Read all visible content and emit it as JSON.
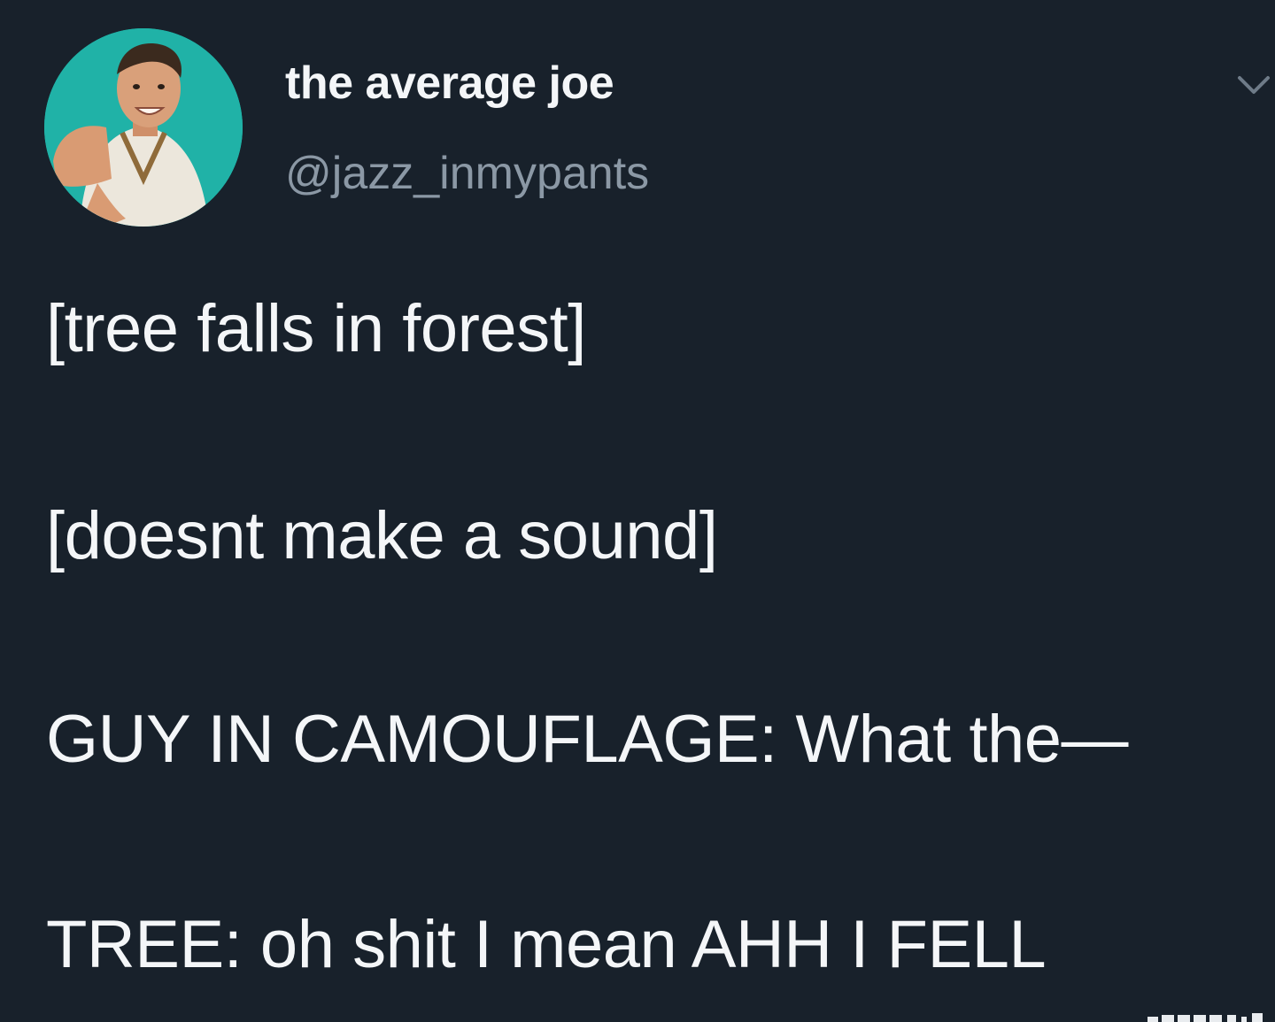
{
  "author": {
    "display_name": "the average joe",
    "handle": "@jazz_inmypants",
    "avatar": "profile-photo-avatar"
  },
  "menu_icon": "chevron-down-icon",
  "tweet": {
    "lines": [
      "[tree falls in forest]",
      "[doesnt make a sound]",
      "GUY IN CAMOUFLAGE: What the—",
      "TREE: oh shit I mean AHH I FELL"
    ]
  },
  "colors": {
    "background": "#18212b",
    "text": "#f4f6f8",
    "handle_text": "#8b98a5",
    "avatar_background": "#1eb3a6"
  }
}
